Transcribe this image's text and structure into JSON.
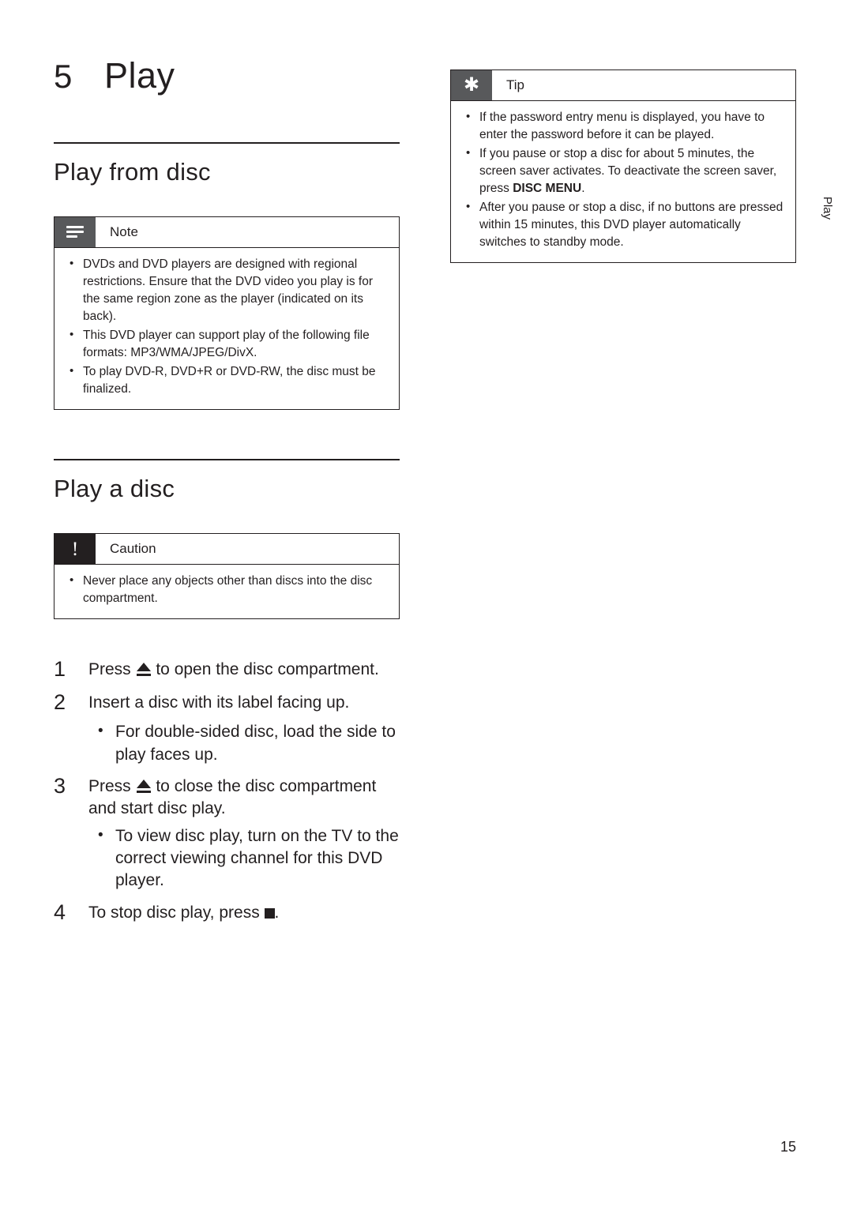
{
  "chapter": {
    "number": "5",
    "title": "Play"
  },
  "sections": {
    "play_from_disc": "Play from disc",
    "play_a_disc": "Play a disc"
  },
  "note_box": {
    "label": "Note",
    "icon": "note-lines-icon",
    "items": [
      "DVDs and DVD players are designed with regional restrictions. Ensure that the DVD video you play is for the same region zone as the player (indicated on its back).",
      "This DVD player can support play of the following file formats: MP3/WMA/JPEG/DivX.",
      "To play DVD-R, DVD+R or DVD-RW, the disc must be finalized."
    ]
  },
  "caution_box": {
    "label": "Caution",
    "icon": "exclamation-icon",
    "items": [
      "Never place any objects other than discs into the disc compartment."
    ]
  },
  "tip_box": {
    "label": "Tip",
    "icon": "asterisk-icon",
    "items": [
      {
        "prefix": "If the password entry menu is displayed, you have to enter the password before it can be played.",
        "bold": "",
        "suffix": ""
      },
      {
        "prefix": "If you pause or stop a disc for about 5 minutes, the screen saver activates. To deactivate the screen saver, press ",
        "bold": "DISC MENU",
        "suffix": "."
      },
      {
        "prefix": "After you pause or stop a disc, if no buttons are pressed within 15 minutes, this DVD player automatically switches to standby mode.",
        "bold": "",
        "suffix": ""
      }
    ]
  },
  "steps": [
    {
      "number": "1",
      "text_before": "Press ",
      "glyph": "eject-icon",
      "text_after": " to open the disc compartment."
    },
    {
      "number": "2",
      "text_before": "Insert a disc with its label facing up.",
      "glyph": "",
      "text_after": "",
      "sub": [
        "For double-sided disc, load the side to play faces up."
      ]
    },
    {
      "number": "3",
      "text_before": "Press ",
      "glyph": "eject-icon",
      "text_after": " to close the disc compartment and start disc play.",
      "sub": [
        "To view disc play, turn on the TV to the correct viewing channel for this DVD player."
      ]
    },
    {
      "number": "4",
      "text_before": "To stop disc play, press ",
      "glyph": "stop-icon",
      "text_after": "."
    }
  ],
  "side_tab": "Play",
  "page_number": "15",
  "colors": {
    "text": "#231f20",
    "note_icon_bg": "#58595b",
    "caution_icon_bg": "#231f20"
  }
}
